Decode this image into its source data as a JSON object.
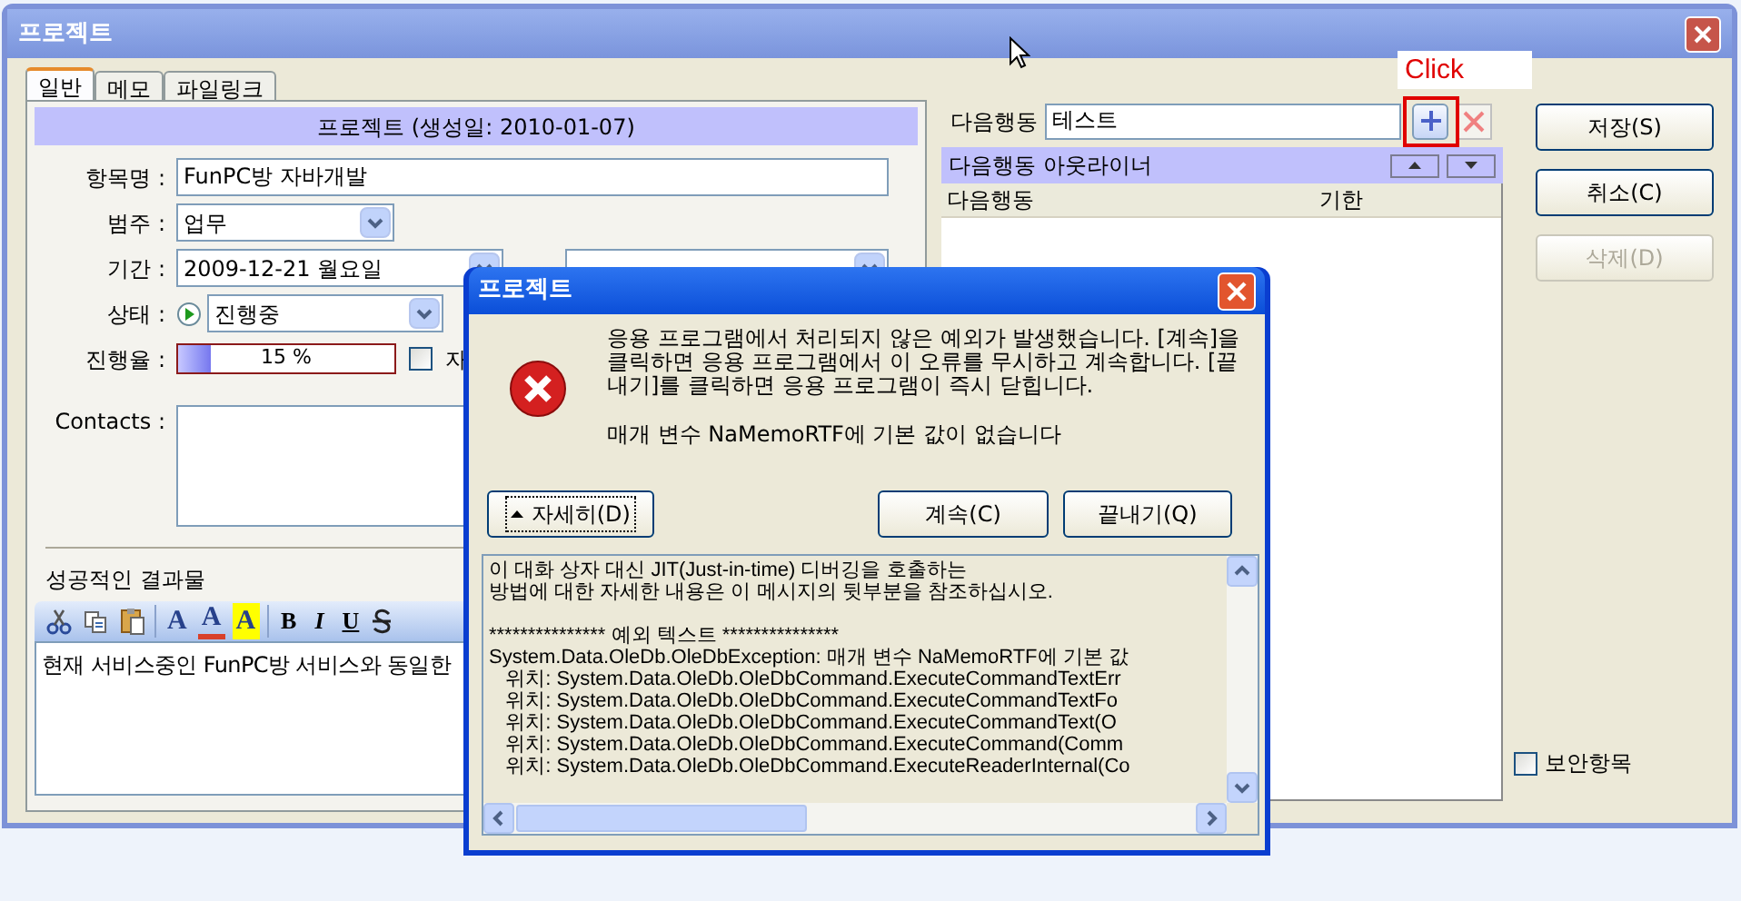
{
  "window": {
    "title": "프로젝트"
  },
  "tabs": [
    {
      "label": "일반",
      "selected": true
    },
    {
      "label": "메모",
      "selected": false
    },
    {
      "label": "파일링크",
      "selected": false
    }
  ],
  "form": {
    "header": "프로젝트 (생성일: 2010-01-07)",
    "fields": [
      {
        "kind": "text",
        "label": "항목명 :",
        "value": "FunPC방 자바개발"
      },
      {
        "kind": "select",
        "label": "범주 :",
        "value": "업무"
      },
      {
        "kind": "date_range",
        "label": "기간 :",
        "value": "2009-12-21 월요일"
      },
      {
        "kind": "status",
        "label": "상태 :",
        "value": "진행중"
      },
      {
        "kind": "progress",
        "label": "진행율 :",
        "level": 0.15,
        "reading": "15 %",
        "checkbox": {
          "label": "자",
          "checked": false
        }
      },
      {
        "kind": "textarea",
        "label": "Contacts :"
      }
    ]
  },
  "results": {
    "label": "성공적인 결과물",
    "toolbar": [
      {
        "kind": "cut"
      },
      {
        "kind": "copy"
      },
      {
        "kind": "paste"
      },
      {
        "kind": "separator"
      },
      {
        "kind": "font",
        "label": "A"
      },
      {
        "kind": "font_color",
        "label": "A"
      },
      {
        "kind": "highlight",
        "label": "A"
      },
      {
        "kind": "separator"
      },
      {
        "kind": "bold",
        "label": "B"
      },
      {
        "kind": "italic",
        "label": "I"
      },
      {
        "kind": "underline",
        "label": "U"
      },
      {
        "kind": "strike"
      }
    ],
    "text": "현재 서비스중인 FunPC방 서비스와 동일한"
  },
  "next_action": {
    "label": "다음행동",
    "value": "테스트"
  },
  "annotation": {
    "text": "Click"
  },
  "outliner": {
    "title": "다음행동 아웃라이너",
    "columns": [
      "다음행동",
      "기한"
    ]
  },
  "buttons": [
    {
      "label": "저장(S)",
      "disabled": false
    },
    {
      "label": "취소(C)",
      "disabled": false
    },
    {
      "label": "삭제(D)",
      "disabled": true
    }
  ],
  "security": {
    "label": "보안항목",
    "checked": false
  },
  "error_dialog": {
    "title": "프로젝트",
    "message": "응용 프로그램에서 처리되지 않은 예외가 발생했습니다. [계속]을 클릭하면 응용 프로그램에서 이 오류를 무시하고 계속합니다. [끝내기]를 클릭하면 응용 프로그램이 즉시 닫힙니다.",
    "message_2": "매개 변수 NaMemoRTF에 기본 값이 없습니다",
    "buttons": [
      {
        "kind": "details",
        "label": "자세히(D)",
        "focused": true
      },
      {
        "kind": "plain",
        "label": "계속(C)",
        "focused": false
      },
      {
        "kind": "plain",
        "label": "끝내기(Q)",
        "focused": false
      }
    ],
    "details_intro": [
      "이 대화 상자 대신 JIT(Just-in-time) 디버깅을 호출하는",
      "방법에 대한 자세한 내용은 이 메시지의 뒷부분을 참조하십시오."
    ],
    "details": [
      "*************** 예외 텍스트 ***************",
      "System.Data.OleDb.OleDbException: 매개 변수 NaMemoRTF에 기본 값",
      "   위치: System.Data.OleDb.OleDbCommand.ExecuteCommandTextErr",
      "   위치: System.Data.OleDb.OleDbCommand.ExecuteCommandTextFo",
      "   위치: System.Data.OleDb.OleDbCommand.ExecuteCommandText(O",
      "   위치: System.Data.OleDb.OleDbCommand.ExecuteCommand(Comm",
      "   위치: System.Data.OleDb.OleDbCommand.ExecuteReaderInternal(Co"
    ]
  }
}
